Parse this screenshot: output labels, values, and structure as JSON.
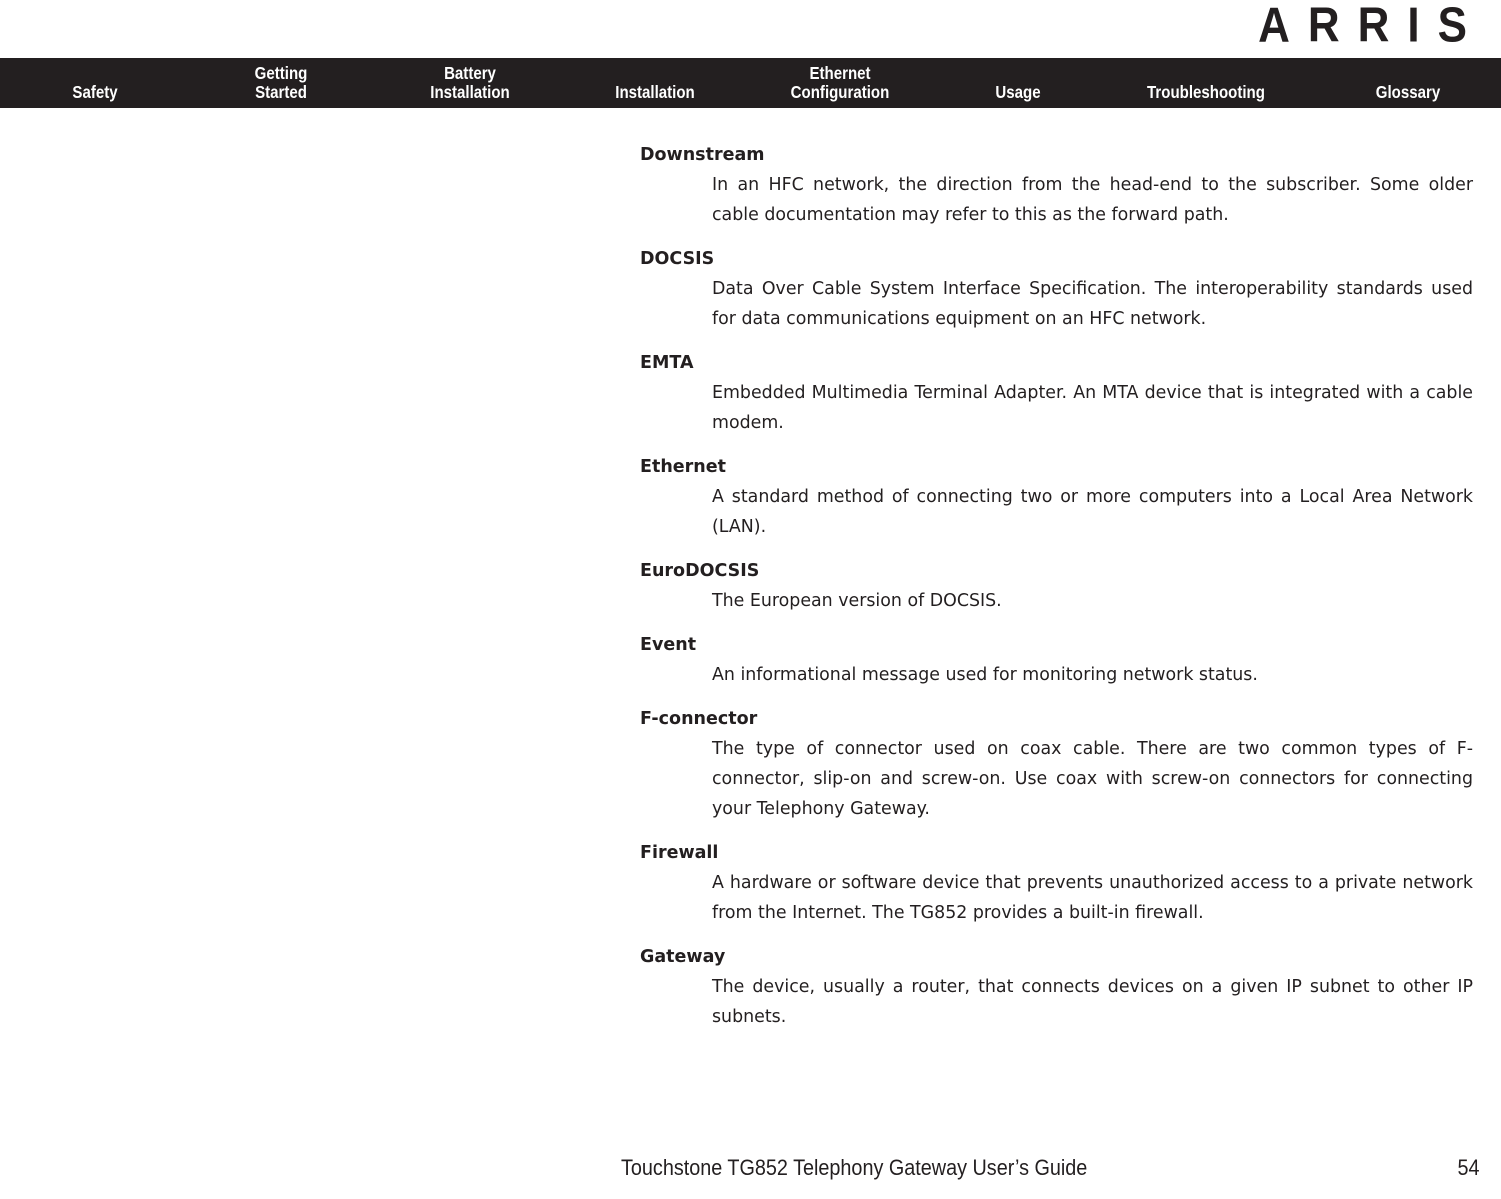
{
  "brand": {
    "logo_text": "ARRIS"
  },
  "nav": {
    "items": [
      {
        "lines": [
          "Safety"
        ],
        "center": 95
      },
      {
        "lines": [
          "Getting",
          "Started"
        ],
        "center": 281
      },
      {
        "lines": [
          "Battery",
          "Installation"
        ],
        "center": 470
      },
      {
        "lines": [
          "Installation"
        ],
        "center": 655
      },
      {
        "lines": [
          "Ethernet",
          "Configuration"
        ],
        "center": 840
      },
      {
        "lines": [
          "Usage"
        ],
        "center": 1018
      },
      {
        "lines": [
          "Troubleshooting"
        ],
        "center": 1206
      },
      {
        "lines": [
          "Glossary"
        ],
        "center": 1408
      }
    ]
  },
  "glossary": {
    "entries": [
      {
        "term": "Downstream",
        "definition": "In an HFC network, the direction from the head-end to the subscriber. Some older cable documentation may refer to this as the forward path."
      },
      {
        "term": "DOCSIS",
        "definition": "Data Over Cable System Interface Specification. The interoperability standards used for data communications equipment on an HFC network."
      },
      {
        "term": "EMTA",
        "definition": "Embedded Multimedia Terminal Adapter. An MTA device that is integrated with a cable modem."
      },
      {
        "term": "Ethernet",
        "definition": "A standard method of connecting two or more computers into a Local Area Network (LAN)."
      },
      {
        "term": "EuroDOCSIS",
        "definition": "The European version of DOCSIS."
      },
      {
        "term": "Event",
        "definition": "An informational message used for monitoring network status."
      },
      {
        "term": "F-connector",
        "definition": "The type of connector used on coax cable. There are two common types of F-connector, slip-on and screw-on. Use coax with screw-on connectors for connecting your Telephony Gateway."
      },
      {
        "term": "Firewall",
        "definition": "A hardware or software device that prevents unauthorized access to a private network from the Internet. The TG852 provides a built-in firewall."
      },
      {
        "term": "Gateway",
        "definition": "The device, usually a router, that connects devices on a given IP subnet to other IP subnets."
      }
    ]
  },
  "footer": {
    "title": "Touchstone TG852 Telephony Gateway User’s Guide",
    "page_number": "54"
  },
  "colors": {
    "navbar_background": "#231f20",
    "text": "#231f20",
    "page_background": "#ffffff",
    "nav_text": "#ffffff"
  }
}
